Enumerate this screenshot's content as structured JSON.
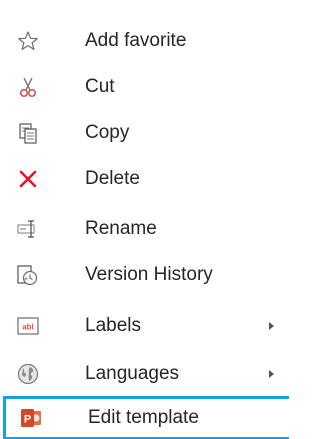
{
  "menu": {
    "items": [
      {
        "label": "Add favorite",
        "icon": "star-outline-icon"
      },
      {
        "label": "Cut",
        "icon": "scissors-icon"
      },
      {
        "label": "Copy",
        "icon": "copy-icon"
      },
      {
        "label": "Delete",
        "icon": "delete-x-icon"
      },
      {
        "label": "Rename",
        "icon": "rename-icon"
      },
      {
        "label": "Version History",
        "icon": "version-history-icon"
      },
      {
        "label": "Labels",
        "icon": "labels-icon",
        "submenu": true
      },
      {
        "label": "Languages",
        "icon": "globe-icon",
        "submenu": true
      },
      {
        "label": "Edit template",
        "icon": "powerpoint-icon",
        "highlighted": true
      }
    ]
  },
  "colors": {
    "highlight_border": "#15a3e0",
    "delete_red": "#e81123",
    "scissors_red": "#d9534f",
    "powerpoint_orange": "#d24726"
  }
}
